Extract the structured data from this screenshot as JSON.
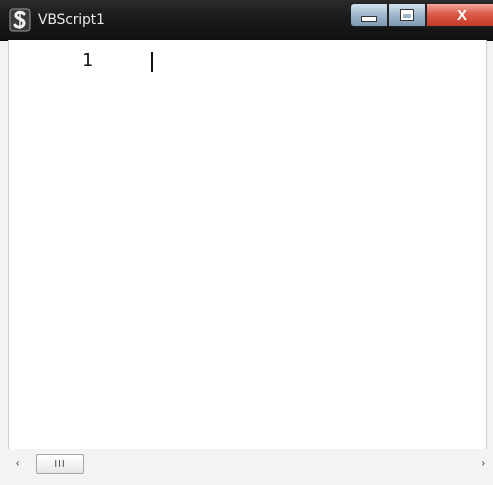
{
  "window": {
    "title": "VBScript1",
    "app_icon": "vbscript-s-icon",
    "controls": {
      "minimize_icon": "minimize-icon",
      "maximize_icon": "maximize-icon",
      "close_label": "X"
    }
  },
  "editor": {
    "line_numbers": [
      "1"
    ],
    "content": ""
  },
  "scrollbar": {
    "left_arrow": "‹",
    "right_arrow": "›",
    "thumb_grip": "III"
  },
  "colors": {
    "titlebar": "#1a1a1a",
    "close": "#c23b27",
    "editor_bg": "#ffffff"
  }
}
